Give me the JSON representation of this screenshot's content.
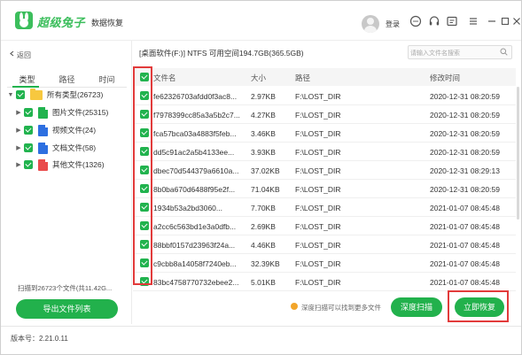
{
  "app": {
    "brand": "超级兔子",
    "subtitle": "数据恢复",
    "login_label": "登录",
    "icons": [
      "help-icon",
      "headset-icon",
      "feedback-icon",
      "menu-icon",
      "minimize-icon",
      "maximize-icon",
      "close-icon"
    ]
  },
  "sidebar": {
    "back_label": "返回",
    "tabs": [
      "类型",
      "路径",
      "时间"
    ],
    "active_tab": 0,
    "tree": [
      {
        "label": "所有类型(26723)",
        "icon": "folder-icon",
        "color": "#f7c83f"
      },
      {
        "label": "图片文件(25315)",
        "icon": "image-file-icon",
        "color": "#21b34e"
      },
      {
        "label": "视频文件(24)",
        "icon": "video-file-icon",
        "color": "#2d6fe0"
      },
      {
        "label": "文档文件(58)",
        "icon": "document-file-icon",
        "color": "#2d6fe0"
      },
      {
        "label": "其他文件(1326)",
        "icon": "other-file-icon",
        "color": "#e94b4b"
      }
    ],
    "scan_info": "扫描到26723个文件(共11.42G...",
    "export_label": "导出文件列表"
  },
  "main": {
    "path": "[桌面软件(F:)] NTFS 可用空间194.7GB(365.5GB)",
    "search_placeholder": "请输入文件名搜索",
    "columns": {
      "name": "文件名",
      "size": "大小",
      "path": "路径",
      "modified": "修改时间"
    },
    "rows": [
      {
        "name": "fe62326703afdd0f3ac8...",
        "size": "2.97KB",
        "path": "F:\\LOST_DIR",
        "modified": "2020-12-31 08:20:59"
      },
      {
        "name": "f7978399cc85a3a5b2c7...",
        "size": "4.27KB",
        "path": "F:\\LOST_DIR",
        "modified": "2020-12-31 08:20:59"
      },
      {
        "name": "fca57bca03a4883f5feb...",
        "size": "3.46KB",
        "path": "F:\\LOST_DIR",
        "modified": "2020-12-31 08:20:59"
      },
      {
        "name": "dd5c91ac2a5b4133ee...",
        "size": "3.93KB",
        "path": "F:\\LOST_DIR",
        "modified": "2020-12-31 08:20:59"
      },
      {
        "name": "dbec70d544379a6610a...",
        "size": "37.02KB",
        "path": "F:\\LOST_DIR",
        "modified": "2020-12-31 08:29:13"
      },
      {
        "name": "8b0ba670d6488f95e2f...",
        "size": "71.04KB",
        "path": "F:\\LOST_DIR",
        "modified": "2020-12-31 08:20:59"
      },
      {
        "name": "1934b53a2bd3060...",
        "size": "7.70KB",
        "path": "F:\\LOST_DIR",
        "modified": "2021-01-07 08:45:48"
      },
      {
        "name": "a2cc6c563bd1e3a0dfb...",
        "size": "2.69KB",
        "path": "F:\\LOST_DIR",
        "modified": "2021-01-07 08:45:48"
      },
      {
        "name": "88bbf0157d23963f24a...",
        "size": "4.46KB",
        "path": "F:\\LOST_DIR",
        "modified": "2021-01-07 08:45:48"
      },
      {
        "name": "c9cbb8a14058f7240eb...",
        "size": "32.39KB",
        "path": "F:\\LOST_DIR",
        "modified": "2021-01-07 08:45:48"
      },
      {
        "name": "83bc4758770732ebee2...",
        "size": "5.01KB",
        "path": "F:\\LOST_DIR",
        "modified": "2021-01-07 08:45:48"
      }
    ],
    "deep_scan_tip": "深度扫描可以找到更多文件",
    "deep_scan_label": "深度扫描",
    "recover_label": "立即恢复"
  },
  "status": {
    "version": "版本号：2.21.0.11"
  },
  "colors": {
    "accent": "#22b14c",
    "highlight": "#e23b3b"
  }
}
